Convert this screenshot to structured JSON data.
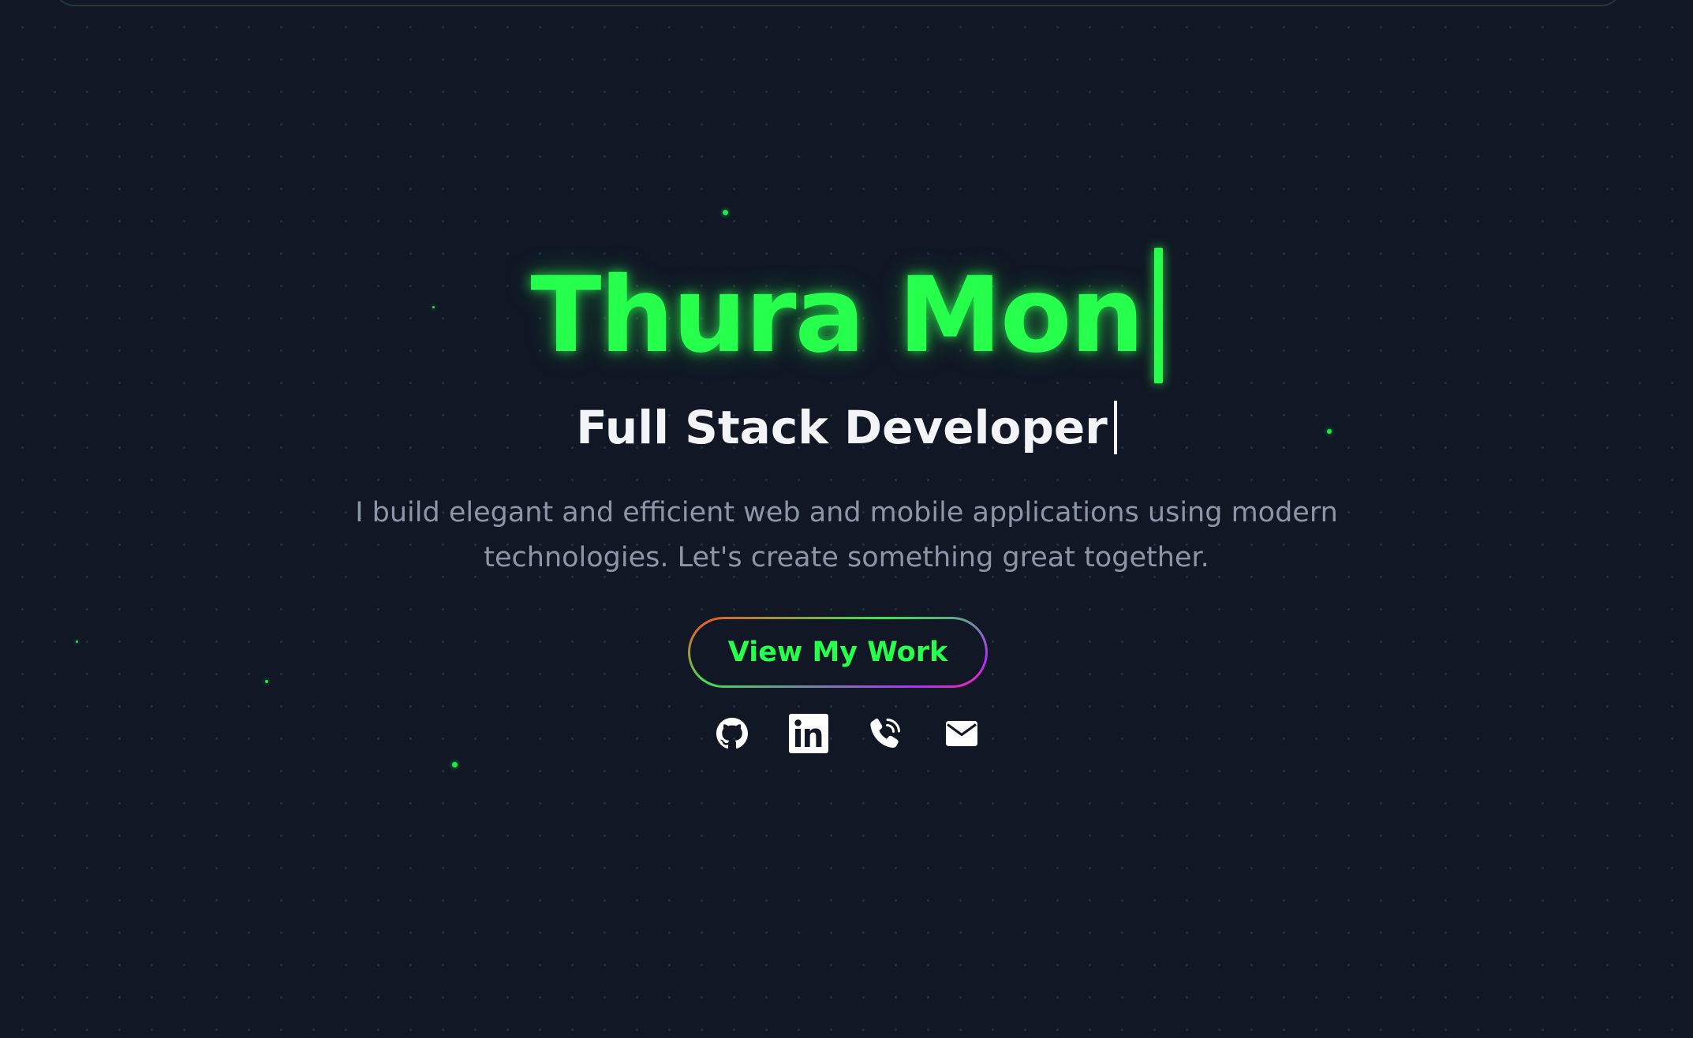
{
  "hero": {
    "name": "Thura Mon",
    "role": "Full Stack Developer",
    "description": "I build elegant and efficient web and mobile applications using modern technologies. Let's create something great together.",
    "cta_label": "View My Work"
  },
  "socials": [
    {
      "icon": "github-icon"
    },
    {
      "icon": "linkedin-icon"
    },
    {
      "icon": "phone-icon"
    },
    {
      "icon": "envelope-icon"
    }
  ],
  "colors": {
    "background": "#111725",
    "accent": "#27ff4d",
    "heading": "#f2f4f8",
    "muted": "#8d96a7"
  }
}
